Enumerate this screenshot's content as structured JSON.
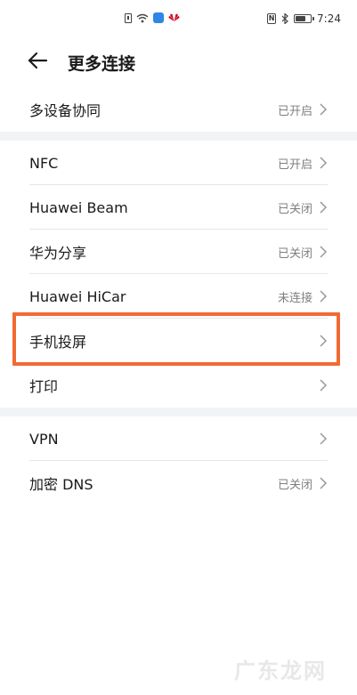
{
  "status_bar": {
    "time": "7:24",
    "icons": [
      "sim-icon",
      "wifi-icon",
      "weather-icon",
      "huawei-icon",
      "nfc-icon",
      "bluetooth-icon",
      "battery-icon"
    ]
  },
  "header": {
    "title": "更多连接",
    "back_icon": "back-arrow-icon"
  },
  "group1": {
    "items": [
      {
        "label": "多设备协同",
        "status": "已开启"
      }
    ]
  },
  "group2": {
    "items": [
      {
        "label": "NFC",
        "status": "已开启"
      },
      {
        "label": "Huawei Beam",
        "status": "已关闭"
      },
      {
        "label": "华为分享",
        "status": "已关闭"
      },
      {
        "label": "Huawei HiCar",
        "status": "未连接"
      },
      {
        "label": "手机投屏",
        "status": ""
      },
      {
        "label": "打印",
        "status": ""
      }
    ]
  },
  "group3": {
    "items": [
      {
        "label": "VPN",
        "status": ""
      },
      {
        "label": "加密 DNS",
        "status": "已关闭"
      }
    ]
  },
  "watermark": "广东龙网",
  "colors": {
    "highlight": "#f26a33",
    "divider": "#f1f3f5",
    "status_text": "#7f7f7f"
  }
}
